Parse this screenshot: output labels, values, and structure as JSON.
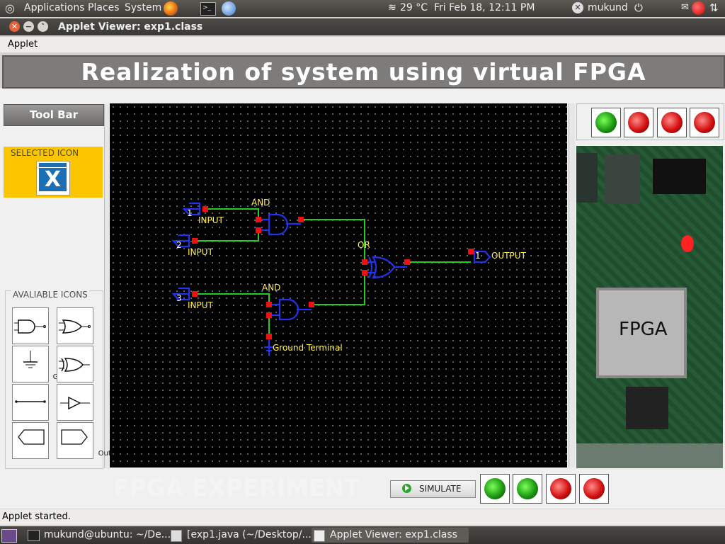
{
  "top_panel": {
    "menu": [
      "Applications",
      "Places",
      "System"
    ],
    "weather": "29 °C",
    "clock": "Fri Feb 18, 12:11 PM",
    "user": "mukund"
  },
  "window": {
    "title": "Applet Viewer: exp1.class",
    "menu": "Applet"
  },
  "banner": "Realization of system using virtual FPGA",
  "toolbar": {
    "button": "Tool Bar",
    "selected_title": "SELECTED ICON",
    "available_title": "AVALIABLE ICONS",
    "icons": [
      "",
      "",
      "Ground",
      "",
      "Wire",
      "",
      "Input",
      "Output"
    ]
  },
  "canvas": {
    "labels": {
      "and1": "AND",
      "and2": "AND",
      "or": "OR",
      "in1_num": "1",
      "in2_num": "2",
      "in3_num": "3",
      "in1": "INPUT",
      "in2": "INPUT",
      "in3": "INPUT",
      "out_num": "1",
      "out": "OUTPUT",
      "ground": "Ground Terminal"
    }
  },
  "right_panel": {
    "leds": [
      "green",
      "red",
      "red",
      "red"
    ],
    "chip_label": "FPGA"
  },
  "bottom": {
    "title": "FPGA EXPERIMENT",
    "simulate": "SIMULATE",
    "leds": [
      "green",
      "green",
      "red",
      "red"
    ]
  },
  "status": "Applet started.",
  "taskbar": [
    "mukund@ubuntu: ~/De...",
    "[exp1.java (~/Desktop/...",
    "Applet Viewer: exp1.class"
  ],
  "colors": {
    "wire": "#22cc22",
    "gate": "#2233ee",
    "pin": "#ee1111",
    "label": "#ffee55",
    "selected_panel": "#fbc600"
  }
}
